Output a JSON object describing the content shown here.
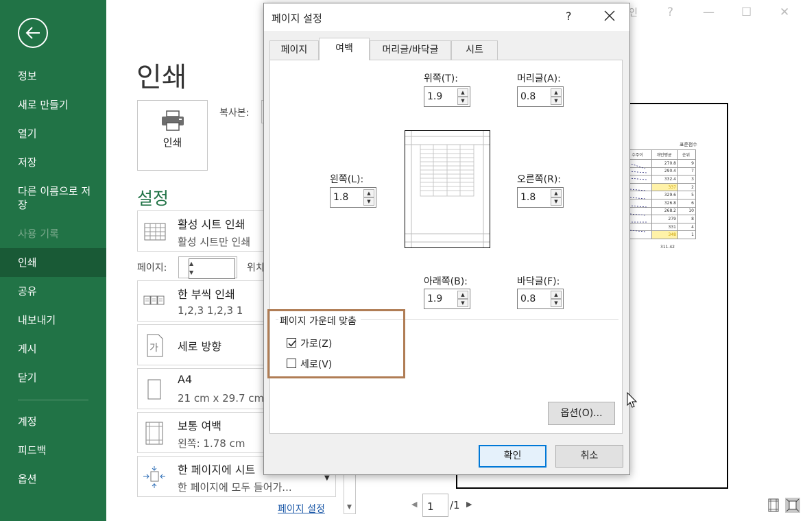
{
  "sidebar": {
    "items": [
      {
        "label": "정보",
        "state": "normal"
      },
      {
        "label": "새로 만들기",
        "state": "normal"
      },
      {
        "label": "열기",
        "state": "normal"
      },
      {
        "label": "저장",
        "state": "normal"
      },
      {
        "label": "다른 이름으로 저장",
        "state": "normal"
      },
      {
        "label": "사용 기록",
        "state": "disabled"
      },
      {
        "label": "인쇄",
        "state": "active"
      },
      {
        "label": "공유",
        "state": "normal"
      },
      {
        "label": "내보내기",
        "state": "normal"
      },
      {
        "label": "게시",
        "state": "normal"
      },
      {
        "label": "닫기",
        "state": "normal"
      },
      {
        "label": "계정",
        "state": "normal"
      },
      {
        "label": "피드백",
        "state": "normal"
      },
      {
        "label": "옵션",
        "state": "normal"
      }
    ],
    "color": "#217346"
  },
  "print": {
    "title": "인쇄",
    "button_label": "인쇄",
    "copies_label": "복사본:",
    "settings_title": "설정",
    "options": [
      {
        "line1": "활성 시트 인쇄",
        "line2": "활성 시트만 인쇄"
      },
      {
        "line1": "한 부씩 인쇄",
        "line2": "1,2,3    1,2,3    1"
      },
      {
        "line1": "세로 방향",
        "line2": ""
      },
      {
        "line1": "A4",
        "line2": "21 cm x 29.7 cm"
      },
      {
        "line1": "보통 여백",
        "line2": "왼쪽:  1.78 cm"
      },
      {
        "line1": "한 페이지에 시트",
        "line2": "한 페이지에 모두 들어가..."
      }
    ],
    "pages_label": "페이지:",
    "pages_to_label": "위치",
    "page_setup_link": "페이지 설정",
    "orientation_glyph": "가"
  },
  "preview": {
    "header": "표준점수",
    "columns": [
      "수주이",
      "개인평균",
      "순위"
    ],
    "rows": [
      {
        "avg": "270.8",
        "rank": "9",
        "hl": false
      },
      {
        "avg": "290.4",
        "rank": "7",
        "hl": false
      },
      {
        "avg": "332.4",
        "rank": "3",
        "hl": false
      },
      {
        "avg": "337",
        "rank": "2",
        "hl": true
      },
      {
        "avg": "329.6",
        "rank": "5",
        "hl": false
      },
      {
        "avg": "326.8",
        "rank": "6",
        "hl": false
      },
      {
        "avg": "268.2",
        "rank": "10",
        "hl": false
      },
      {
        "avg": "279",
        "rank": "8",
        "hl": false
      },
      {
        "avg": "331",
        "rank": "4",
        "hl": false
      },
      {
        "avg": "348",
        "rank": "1",
        "hl": true
      }
    ],
    "total": "311.42",
    "current_page": "1",
    "total_pages": "/1"
  },
  "window": {
    "signin": "인",
    "help": "?"
  },
  "dialog": {
    "title": "페이지 설정",
    "help": "?",
    "tabs": [
      {
        "label": "페이지",
        "active": false
      },
      {
        "label": "여백",
        "active": true
      },
      {
        "label": "머리글/바닥글",
        "active": false
      },
      {
        "label": "시트",
        "active": false
      }
    ],
    "margins": {
      "top_label": "위쪽(T):",
      "top_value": "1.9",
      "header_label": "머리글(A):",
      "header_value": "0.8",
      "left_label": "왼쪽(L):",
      "left_value": "1.8",
      "right_label": "오른쪽(R):",
      "right_value": "1.8",
      "bottom_label": "아래쪽(B):",
      "bottom_value": "1.9",
      "footer_label": "바닥글(F):",
      "footer_value": "0.8"
    },
    "center_on_page": {
      "legend": "페이지 가운데 맞춤",
      "horizontal_label": "가로(Z)",
      "horizontal_checked": true,
      "vertical_label": "세로(V)",
      "vertical_checked": false
    },
    "options_button": "옵션(O)...",
    "ok_button": "확인",
    "cancel_button": "취소",
    "highlight_color": "#b07d55"
  }
}
